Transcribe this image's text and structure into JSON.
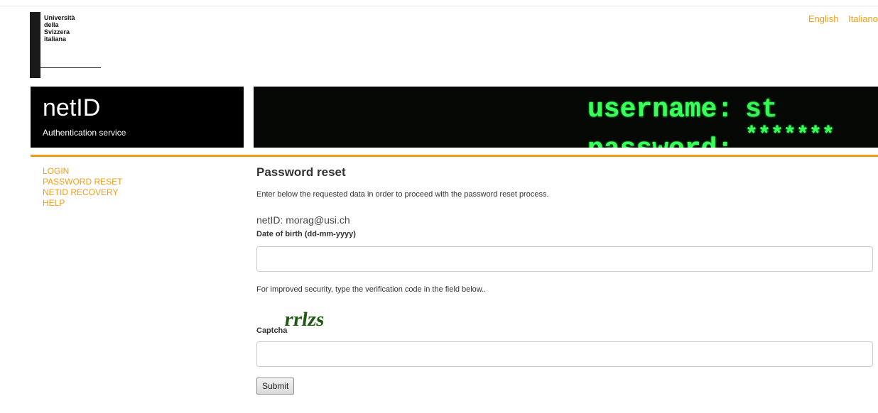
{
  "university": {
    "logo_lines": [
      "Università",
      "della",
      "Svizzera",
      "italiana"
    ]
  },
  "languages": [
    "English",
    "Italiano"
  ],
  "brand": {
    "title": "netID",
    "subtitle": "Authentication service"
  },
  "banner": {
    "line1": "username:",
    "line1_value": "st",
    "line2": "password:",
    "line2_value": "*******"
  },
  "nav": {
    "items": [
      "LOGIN",
      "PASSWORD RESET",
      "NETID RECOVERY",
      "HELP"
    ]
  },
  "main": {
    "title": "Password reset",
    "intro": "Enter below the requested data in order to proceed with the password reset process.",
    "netid_label": "netID:",
    "netid_value": "morag@usi.ch",
    "dob_label": "Date of birth (dd-mm-yyyy)",
    "dob_value": "",
    "security_note": "For improved security, type the verification code in the field below..",
    "captcha_text": "rrlzs",
    "captcha_label": "Captcha",
    "captcha_value": "",
    "submit_label": "Submit"
  },
  "colors": {
    "accent": "#f39c12",
    "banner_text": "#39ff5a"
  }
}
